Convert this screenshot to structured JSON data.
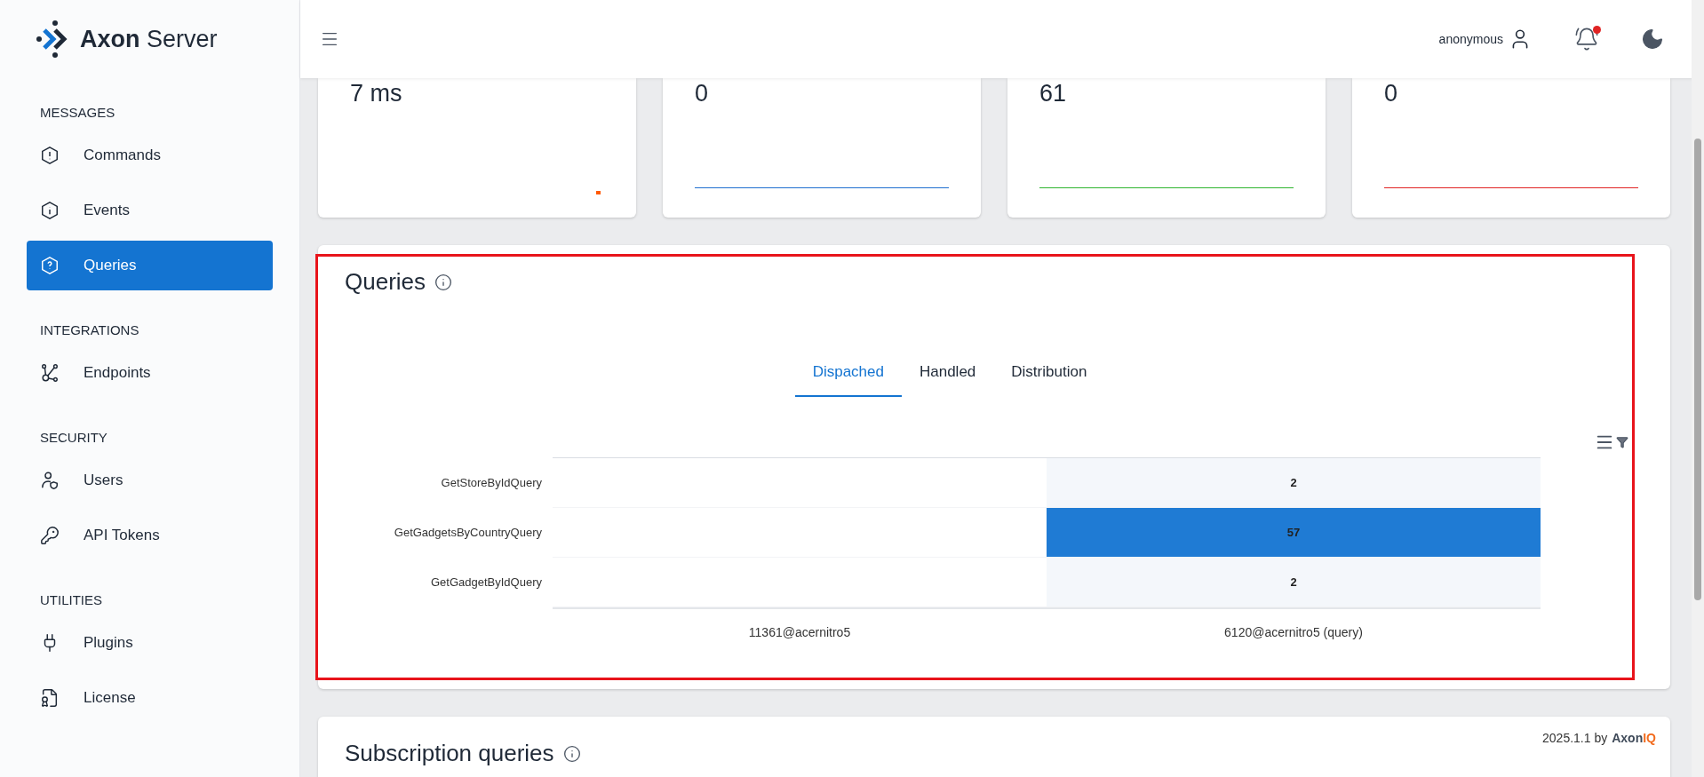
{
  "logo": {
    "bold": "Axon",
    "light": "Server"
  },
  "sidebar": {
    "sections": [
      {
        "heading": "MESSAGES",
        "items": [
          {
            "label": "Commands",
            "kind": "command",
            "selected": false
          },
          {
            "label": "Events",
            "kind": "event",
            "selected": false
          },
          {
            "label": "Queries",
            "kind": "query",
            "selected": true
          }
        ]
      },
      {
        "heading": "INTEGRATIONS",
        "items": [
          {
            "label": "Endpoints",
            "kind": "endpoint",
            "selected": false
          }
        ]
      },
      {
        "heading": "SECURITY",
        "items": [
          {
            "label": "Users",
            "kind": "user",
            "selected": false
          },
          {
            "label": "API Tokens",
            "kind": "token",
            "selected": false
          }
        ]
      },
      {
        "heading": "UTILITIES",
        "items": [
          {
            "label": "Plugins",
            "kind": "plugin",
            "selected": false
          },
          {
            "label": "License",
            "kind": "license",
            "selected": false
          }
        ]
      }
    ]
  },
  "header": {
    "user": "anonymous",
    "has_notification": true
  },
  "stat_cards": [
    {
      "value": "7 ms",
      "kind": "dot",
      "color": "#ff5a00"
    },
    {
      "value": "0",
      "kind": "line",
      "color": "#1f6fd0"
    },
    {
      "value": "61",
      "kind": "line",
      "color": "#2fb52f"
    },
    {
      "value": "0",
      "kind": "line",
      "color": "#e02424"
    }
  ],
  "queries": {
    "title": "Queries",
    "highlighted": true,
    "tabs": [
      {
        "label": "Dispached",
        "selected": true
      },
      {
        "label": "Handled",
        "selected": false
      },
      {
        "label": "Distribution",
        "selected": false
      }
    ],
    "heatmap": {
      "rows": [
        {
          "label": "GetStoreByIdQuery",
          "cells": [
            {
              "color": "#ffffff"
            },
            {
              "value": "2",
              "color": "#f4f7fb"
            }
          ]
        },
        {
          "label": "GetGadgetsByCountryQuery",
          "cells": [
            {
              "color": "#ffffff"
            },
            {
              "value": "57",
              "color": "#1f7bd4"
            }
          ]
        },
        {
          "label": "GetGadgetByIdQuery",
          "cells": [
            {
              "color": "#ffffff"
            },
            {
              "value": "2",
              "color": "#f4f7fb"
            }
          ]
        }
      ],
      "x_axis_labels": [
        "11361@acernitro5",
        "6120@acernitro5 (query)"
      ]
    }
  },
  "subscription": {
    "title": "Subscription queries"
  },
  "version": {
    "text": "2025.1.1 by",
    "brand_dark": "Axon",
    "brand_accent": "IQ"
  }
}
